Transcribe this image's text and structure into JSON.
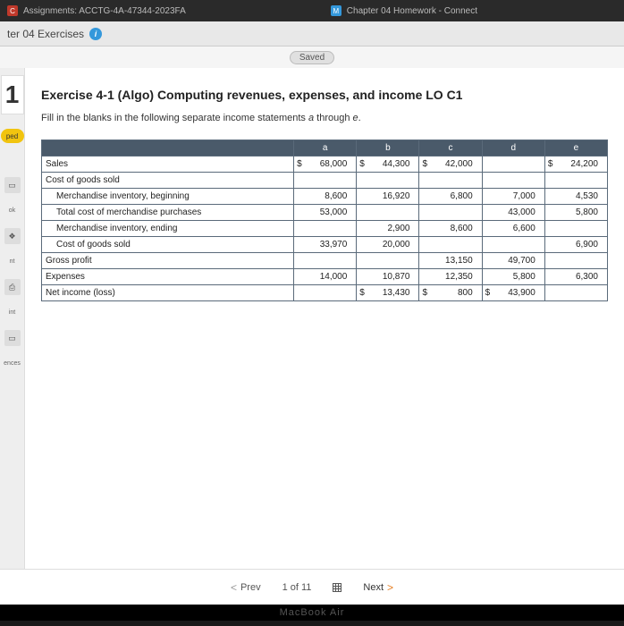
{
  "browser": {
    "tab1": "Assignments: ACCTG-4A-47344-2023FA",
    "tab2": "Chapter 04 Homework - Connect"
  },
  "subbar": {
    "title": "ter 04 Exercises"
  },
  "saved": "Saved",
  "rail": {
    "one": "1",
    "ped": "ped",
    "ok": "ok",
    "nt": "nt",
    "int": "int",
    "ences": "ences"
  },
  "exercise": {
    "title": "Exercise 4-1 (Algo) Computing revenues, expenses, and income LO C1",
    "sub_pre": "Fill in the blanks in the following separate income statements ",
    "sub_em": "a",
    "sub_mid": " through ",
    "sub_em2": "e",
    "sub_post": "."
  },
  "cols": {
    "a": "a",
    "b": "b",
    "c": "c",
    "d": "d",
    "e": "e"
  },
  "rows": {
    "sales": "Sales",
    "cogs": "Cost of goods sold",
    "mib": "Merchandise inventory, beginning",
    "tcmp": "Total cost of merchandise purchases",
    "mie": "Merchandise inventory, ending",
    "cogsold": "Cost of goods sold",
    "gp": "Gross profit",
    "exp": "Expenses",
    "ni": "Net income (loss)"
  },
  "vals": {
    "sales_a": "68,000",
    "sales_b": "44,300",
    "sales_c": "42,000",
    "sales_e": "24,200",
    "mib_a": "8,600",
    "mib_b": "16,920",
    "mib_c": "6,800",
    "mib_d": "7,000",
    "mib_e": "4,530",
    "tcmp_a": "53,000",
    "tcmp_d": "43,000",
    "tcmp_e": "5,800",
    "mie_b": "2,900",
    "mie_c": "8,600",
    "mie_d": "6,600",
    "cogsold_a": "33,970",
    "cogsold_b": "20,000",
    "cogsold_e": "6,900",
    "gp_c": "13,150",
    "gp_d": "49,700",
    "exp_a": "14,000",
    "exp_b": "10,870",
    "exp_c": "12,350",
    "exp_d": "5,800",
    "exp_e": "6,300",
    "ni_b": "13,430",
    "ni_c": "800",
    "ni_d": "43,900"
  },
  "cur": "$",
  "footer": {
    "prev": "Prev",
    "pos": "1 of 11",
    "next": "Next"
  },
  "mac": "MacBook Air"
}
